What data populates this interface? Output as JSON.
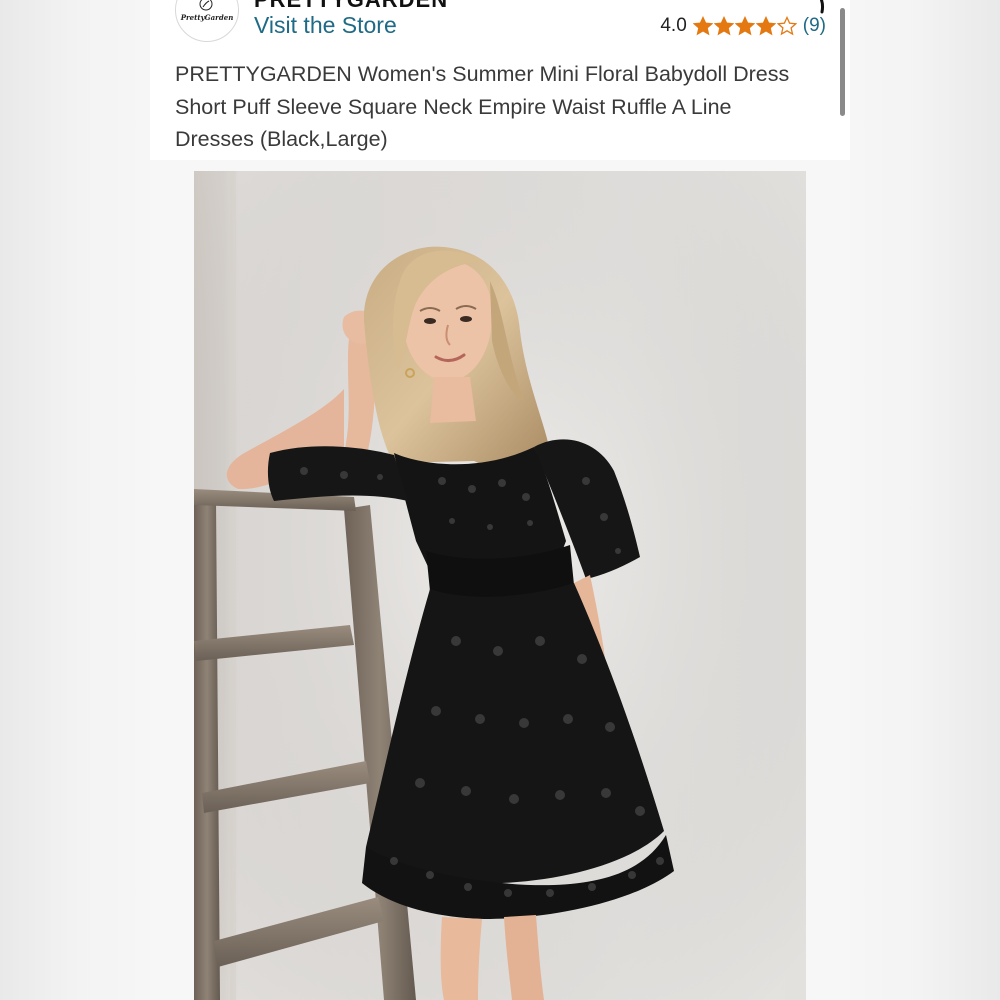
{
  "store": {
    "brand": "PRETTYGARDEN",
    "logo_text": "PrettyGarden",
    "visit_label": "Visit the Store"
  },
  "rating": {
    "value": "4.0",
    "stars_filled": 4,
    "stars_total": 5,
    "count": "(9)",
    "star_color": "#e47911"
  },
  "product": {
    "title": "PRETTYGARDEN Women's Summer Mini Floral Babydoll Dress Short Puff Sleeve Square Neck Empire Waist Ruffle A Line Dresses (Black,Large)"
  },
  "colors": {
    "link": "#1f6a86",
    "text": "#3a3a3a",
    "dress": "#141414"
  }
}
